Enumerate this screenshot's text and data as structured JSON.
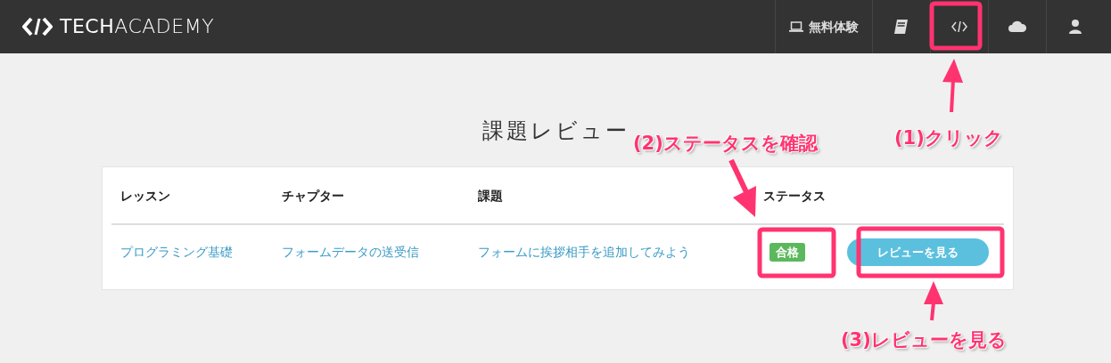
{
  "navbar": {
    "logo": "**TECH**ACADEMY",
    "trial_link": "無料体験"
  },
  "page_title": "課題レビュー",
  "table": {
    "columns": [
      "レッスン",
      "チャプター",
      "課題",
      "ステータス"
    ],
    "rows": [
      {
        "lesson": "プログラミング基礎",
        "chapter": "フォームデータの送受信",
        "assignment": "フォームに挨拶相手を追加してみよう",
        "status": "合格",
        "button": "レビューを見る"
      }
    ]
  },
  "annotations": [
    {
      "label": "(1)クリック"
    },
    {
      "label": "(2)ステータスを確認"
    },
    {
      "label": "(3)レビューを見る"
    }
  ]
}
